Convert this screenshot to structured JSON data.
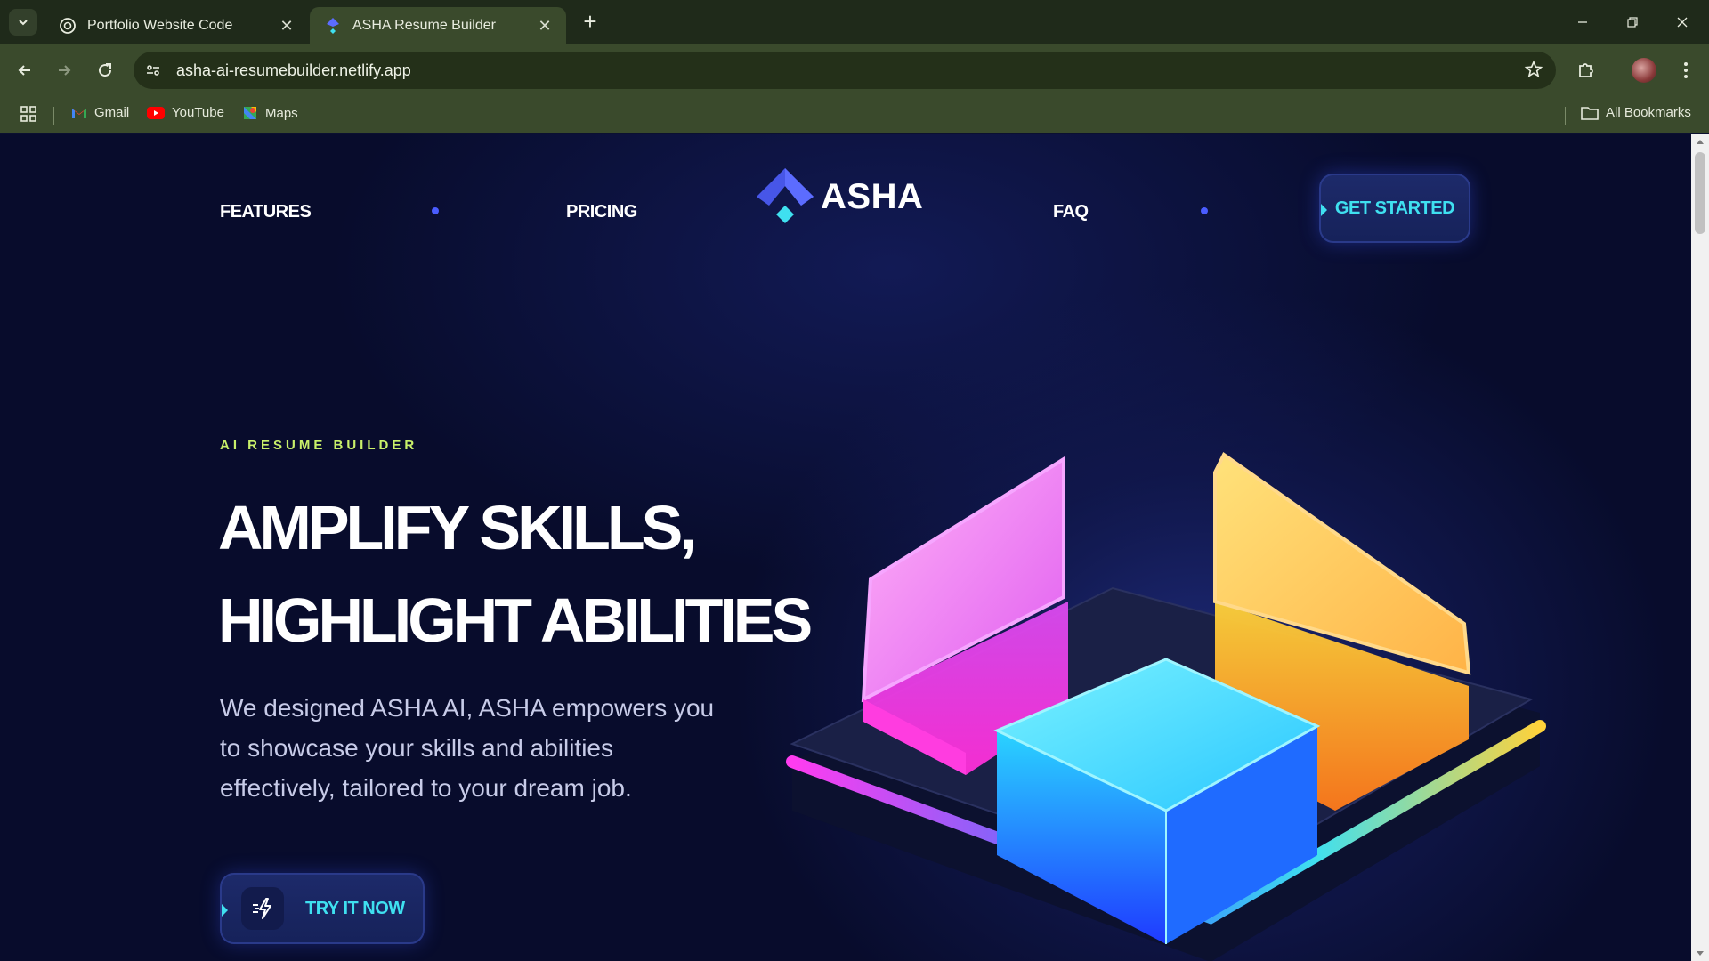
{
  "browser": {
    "tabs": [
      {
        "title": "Portfolio Website Code",
        "active": false,
        "icon": "openai-icon"
      },
      {
        "title": "ASHA Resume Builder",
        "active": true,
        "icon": "asha-logo-icon"
      }
    ],
    "address": "asha-ai-resumebuilder.netlify.app",
    "bookmarks": [
      {
        "label": "Gmail",
        "icon": "gmail-icon"
      },
      {
        "label": "YouTube",
        "icon": "youtube-icon"
      },
      {
        "label": "Maps",
        "icon": "maps-icon"
      }
    ],
    "all_bookmarks_label": "All Bookmarks"
  },
  "nav": {
    "features": "FEATURES",
    "pricing": "PRICING",
    "logo_text": "ASHA",
    "faq": "FAQ",
    "cta": "GET STARTED"
  },
  "hero": {
    "eyebrow": "AI RESUME BUILDER",
    "headline_line1": "AMPLIFY SKILLS,",
    "headline_line2": "HIGHLIGHT ABILITIES",
    "lead": "We designed ASHA AI, ASHA empowers you to showcase your skills and abilities effectively, tailored to your dream job.",
    "button": "TRY IT NOW"
  },
  "colors": {
    "accent_cyan": "#3fe0f0",
    "eyebrow_green": "#c9f06a",
    "brand_blue": "#4a5cff",
    "page_bg": "#080c2c"
  }
}
